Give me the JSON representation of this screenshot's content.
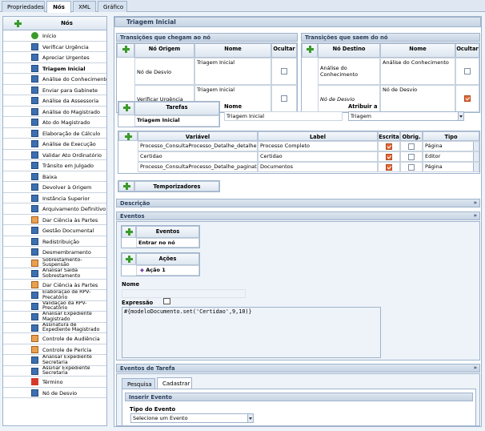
{
  "tabs": [
    "Propriedades",
    "Nós",
    "XML",
    "Gráfico"
  ],
  "nodes_panel": {
    "title": "Nós",
    "items": [
      {
        "label": "Início",
        "icon": "start-icon"
      },
      {
        "label": "Verificar Urgência",
        "icon": "task-icon"
      },
      {
        "label": "Apreciar Urgentes",
        "icon": "task-icon"
      },
      {
        "label": "Triagem Inicial",
        "icon": "task-icon",
        "selected": true
      },
      {
        "label": "Análise do Conhecimento",
        "icon": "task-icon"
      },
      {
        "label": "Enviar para Gabinete",
        "icon": "task-icon"
      },
      {
        "label": "Análise da Assessoria",
        "icon": "task-icon"
      },
      {
        "label": "Análise do Magistrado",
        "icon": "task-icon"
      },
      {
        "label": "Ato do Magistrado",
        "icon": "task-icon"
      },
      {
        "label": "Elaboração de Cálculo",
        "icon": "task-icon"
      },
      {
        "label": "Análise de Execução",
        "icon": "task-icon"
      },
      {
        "label": "Validar Ato Ordinatório",
        "icon": "task-icon"
      },
      {
        "label": "Trânsito em Julgado",
        "icon": "task-icon"
      },
      {
        "label": "Baixa",
        "icon": "task-icon"
      },
      {
        "label": "Devolver à Origem",
        "icon": "task-icon"
      },
      {
        "label": "Instância Superior",
        "icon": "task-icon"
      },
      {
        "label": "Arquivamento Definitivo",
        "icon": "task-icon"
      },
      {
        "label": "Dar Ciência às Partes",
        "icon": "subprocess-icon"
      },
      {
        "label": "Gestão Documental",
        "icon": "task-icon"
      },
      {
        "label": "Redistribuição",
        "icon": "task-icon"
      },
      {
        "label": "Desmembramento",
        "icon": "task-icon"
      },
      {
        "label": "Sobrestamento-Suspensão",
        "icon": "subprocess-icon",
        "two": true
      },
      {
        "label": "Analisar Saída Sobrestamento",
        "icon": "task-icon",
        "two": true
      },
      {
        "label": "Dar Ciência às Partes",
        "icon": "subprocess-icon"
      },
      {
        "label": "Elaboração de RPV-Precatório",
        "icon": "task-icon",
        "two": true
      },
      {
        "label": "Validação da RPV-Precatório",
        "icon": "task-icon",
        "two": true
      },
      {
        "label": "Analisar Expediente Magistrado",
        "icon": "task-icon",
        "two": true
      },
      {
        "label": "Assinatura de Expediente Magistrado",
        "icon": "task-icon",
        "two": true
      },
      {
        "label": "Controle de Audiência",
        "icon": "subprocess-icon"
      },
      {
        "label": "Controle de Perícia",
        "icon": "subprocess-icon"
      },
      {
        "label": "Analisar Expediente Secretaria",
        "icon": "task-icon",
        "two": true
      },
      {
        "label": "Assinar Expediente Secretaria",
        "icon": "task-icon",
        "two": true
      },
      {
        "label": "Término",
        "icon": "end-icon"
      },
      {
        "label": "Nó de Desvio",
        "icon": "task-icon"
      }
    ]
  },
  "node_title": "Triagem Inicial",
  "incoming": {
    "title": "Transições que chegam ao nó",
    "headers": [
      "Nó Origem",
      "Nome",
      "Ocultar"
    ],
    "rows": [
      {
        "origin": "Nó de Desvio",
        "name": "Triagem Inicial",
        "hide": false
      },
      {
        "origin": "Verificar Urgência",
        "name": "Triagem Inicial",
        "hide": false
      }
    ]
  },
  "outgoing": {
    "title": "Transições que saem do nó",
    "headers": [
      "Nó Destino",
      "Nome",
      "Ocultar"
    ],
    "rows": [
      {
        "dest": "Análise do Conhecimento",
        "name": "Análise do Conhecimento",
        "hide": false
      },
      {
        "dest": "Nó de Desvio",
        "name": "Nó de Desvio",
        "hide": true
      }
    ]
  },
  "tasks": {
    "header": "Tarefas",
    "item": "Triagem Inicial",
    "name_label": "Nome",
    "name_value": "Triagem Inicial",
    "assign_label": "Atribuir a",
    "assign_value": "Triagem"
  },
  "variables": {
    "headers": [
      "Variável",
      "Label",
      "Escrita",
      "Obrig.",
      "Tipo"
    ],
    "rows": [
      {
        "var": "Processo_ConsultaProcesso_Detalhe_detalheP",
        "label": "Processo Completo",
        "write": true,
        "req": false,
        "type": "Página"
      },
      {
        "var": "Certidao",
        "label": "Certidao",
        "write": true,
        "req": false,
        "type": "Editor"
      },
      {
        "var": "Processo_ConsultaProcesso_Detalhe_paginato",
        "label": "Documentos",
        "write": true,
        "req": false,
        "type": "Página"
      }
    ]
  },
  "timers": {
    "header": "Temporizadores"
  },
  "sections": {
    "description": "Descrição",
    "events": "Eventos",
    "task_events": "Eventos de Tarefa"
  },
  "events_table": {
    "header": "Eventos",
    "item": "Entrar no nó"
  },
  "actions_table": {
    "header": "Ações",
    "item": "Ação 1"
  },
  "name_label": "Nome",
  "expression_label": "Expressão",
  "expression_value": "#{modeloDocumento.set('Certidao',9,10)}",
  "task_events_tabs": [
    "Pesquisa",
    "Cadastrar"
  ],
  "insert_event": {
    "title": "Inserir Evento",
    "type_label": "Tipo do Evento",
    "type_value": "Selecione um Evento"
  },
  "colors": {
    "accent": "#3a9a2a",
    "checked": "#e06a3a",
    "header": "#c7d4e4"
  }
}
